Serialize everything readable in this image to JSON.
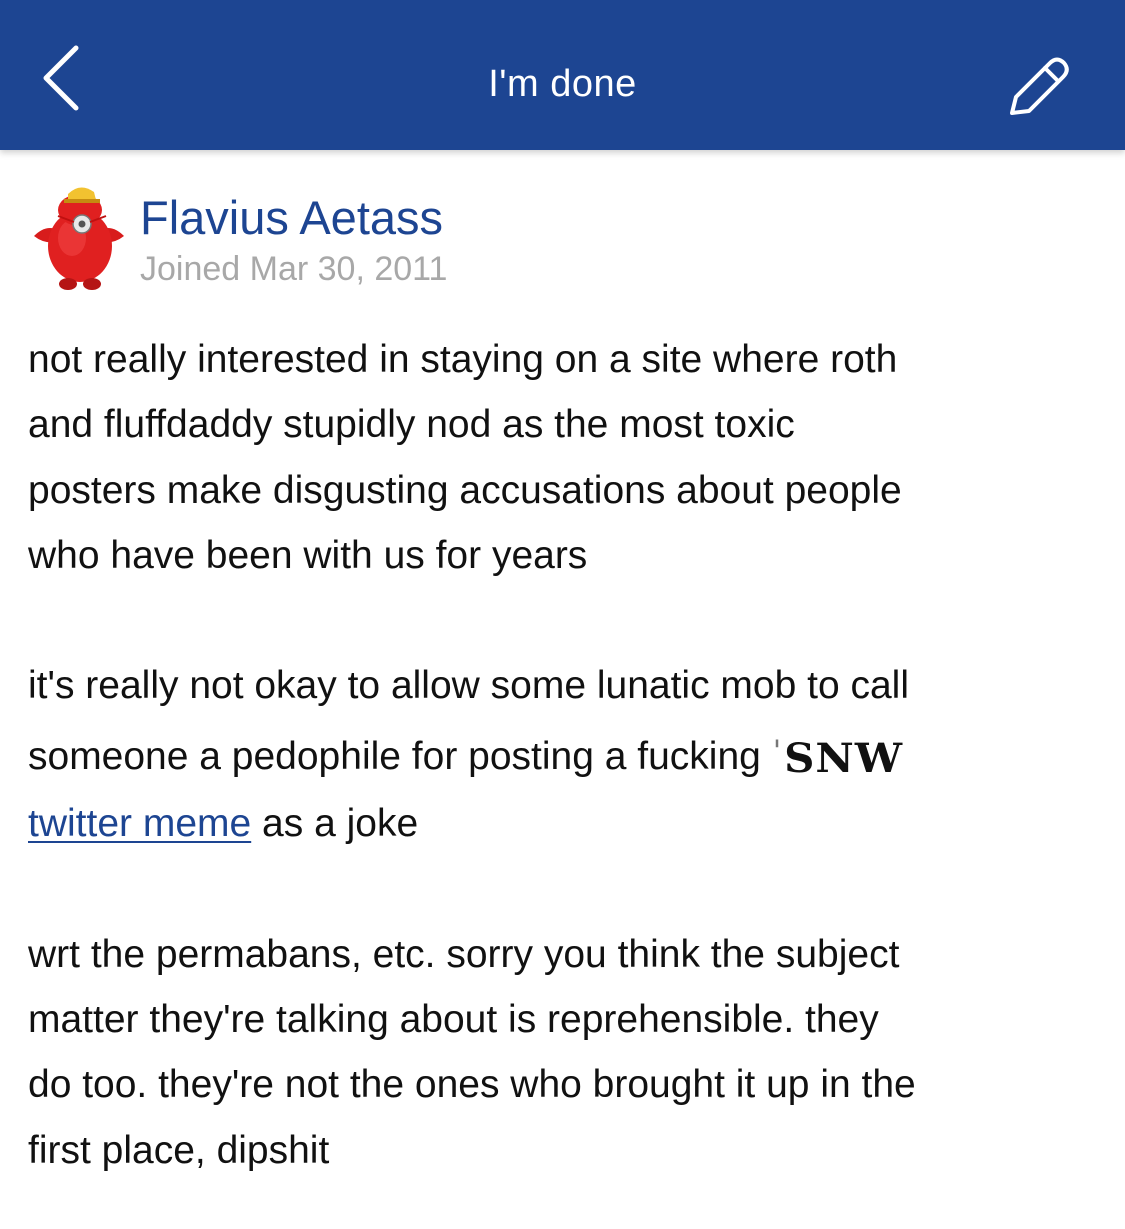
{
  "navbar": {
    "title": "I'm done",
    "background": "#1d4592"
  },
  "post": {
    "author": "Flavius Aetass",
    "joined": "Joined Mar 30, 2011",
    "paragraph1": {
      "line1": "not really interested in staying on a site where roth",
      "line2": "and fluffdaddy stupidly nod as the most toxic",
      "line3": "posters make disgusting accusations about people",
      "line4": "who have been with us for years"
    },
    "paragraph2": {
      "line1": "it's really not okay to allow some lunatic mob to call",
      "line2_text": "someone a pedophile for posting a fucking",
      "emoji_text": "SNW",
      "link_text": "twitter meme",
      "after_link": " as a joke"
    },
    "paragraph3": {
      "line1": "wrt the permabans, etc. sorry you think the subject",
      "line2": "matter they're talking about is reprehensible. they",
      "line3": "do too. they're not the ones who brought it up in the",
      "line4": "first place, dipshit"
    }
  },
  "icons": {
    "back": "chevron-left-icon",
    "edit": "pencil-icon",
    "avatar": "red-character-avatar"
  },
  "colors": {
    "accent": "#1d4592",
    "muted_text": "#a8a8a8",
    "body_text": "#111111"
  }
}
